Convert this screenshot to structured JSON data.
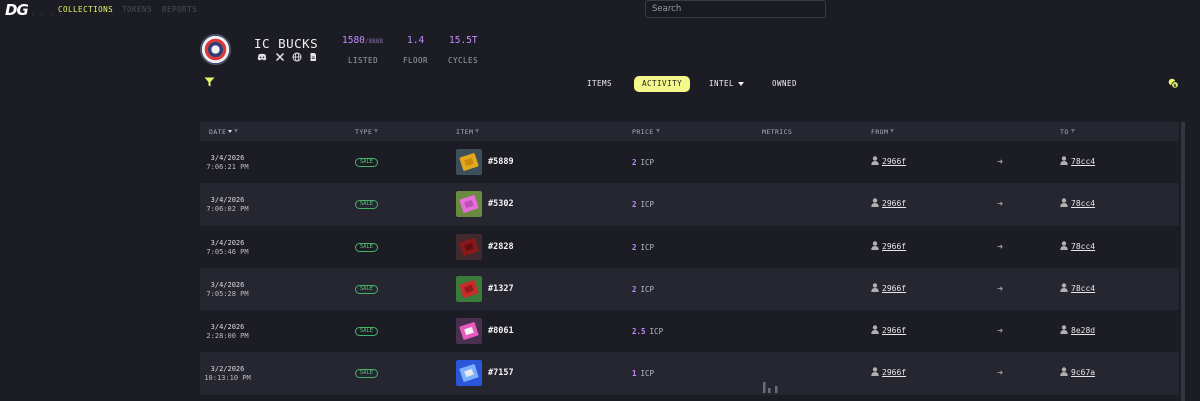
{
  "nav": {
    "logo": "DG",
    "links": [
      "COLLECTIONS",
      "TOKENS",
      "REPORTS"
    ],
    "search_placeholder": "Search"
  },
  "collection": {
    "title": "IC BUCKS",
    "stats": [
      {
        "value": "1580",
        "sub": "/8888",
        "label": "LISTED"
      },
      {
        "value": "1.4",
        "sub": "",
        "label": "FLOOR"
      },
      {
        "value": "15.5T",
        "sub": "",
        "label": "CYCLES"
      }
    ],
    "socials": [
      "discord-icon",
      "x-icon",
      "globe-icon",
      "document-icon"
    ]
  },
  "tabs": [
    {
      "label": "ITEMS",
      "active": false
    },
    {
      "label": "ACTIVITY",
      "active": true
    },
    {
      "label": "INTEL",
      "active": false,
      "dropdown": true
    },
    {
      "label": "OWNED",
      "active": false
    }
  ],
  "table": {
    "headers": [
      "DATE",
      "TYPE",
      "ITEM",
      "PRICE",
      "METRICS",
      "FROM",
      "TO"
    ],
    "rows": [
      {
        "date": "3/4/2026",
        "time": "7:06:21 PM",
        "type": "SALE",
        "item": "#5889",
        "price": "2",
        "unit": "ICP",
        "from": "2966f",
        "to": "78cc4",
        "thumb": [
          "#3d4f5a",
          "#e2a91d",
          "#c98a12"
        ]
      },
      {
        "date": "3/4/2026",
        "time": "7:06:02 PM",
        "type": "SALE",
        "item": "#5302",
        "price": "2",
        "unit": "ICP",
        "from": "2966f",
        "to": "78cc4",
        "thumb": [
          "#6a8a40",
          "#e46fd8",
          "#c04fb8"
        ]
      },
      {
        "date": "3/4/2026",
        "time": "7:05:46 PM",
        "type": "SALE",
        "item": "#2828",
        "price": "2",
        "unit": "ICP",
        "from": "2966f",
        "to": "78cc4",
        "thumb": [
          "#402a2e",
          "#8a1818",
          "#5e0f0f"
        ]
      },
      {
        "date": "3/4/2026",
        "time": "7:05:28 PM",
        "type": "SALE",
        "item": "#1327",
        "price": "2",
        "unit": "ICP",
        "from": "2966f",
        "to": "78cc4",
        "thumb": [
          "#3a7a3a",
          "#c92a2a",
          "#8e1e1e"
        ]
      },
      {
        "date": "3/4/2026",
        "time": "2:28:00 PM",
        "type": "SALE",
        "item": "#8061",
        "price": "2.5",
        "unit": "ICP",
        "from": "2966f",
        "to": "8e28d",
        "thumb": [
          "#4a3050",
          "#e85bbd",
          "#f4f4f4"
        ]
      },
      {
        "date": "3/2/2026",
        "time": "10:13:10 PM",
        "type": "SALE",
        "item": "#7157",
        "price": "1",
        "unit": "ICP",
        "from": "2966f",
        "to": "9c67a",
        "thumb": [
          "#2c56d8",
          "#7ab0ff",
          "#e8e8e8"
        ]
      }
    ]
  }
}
